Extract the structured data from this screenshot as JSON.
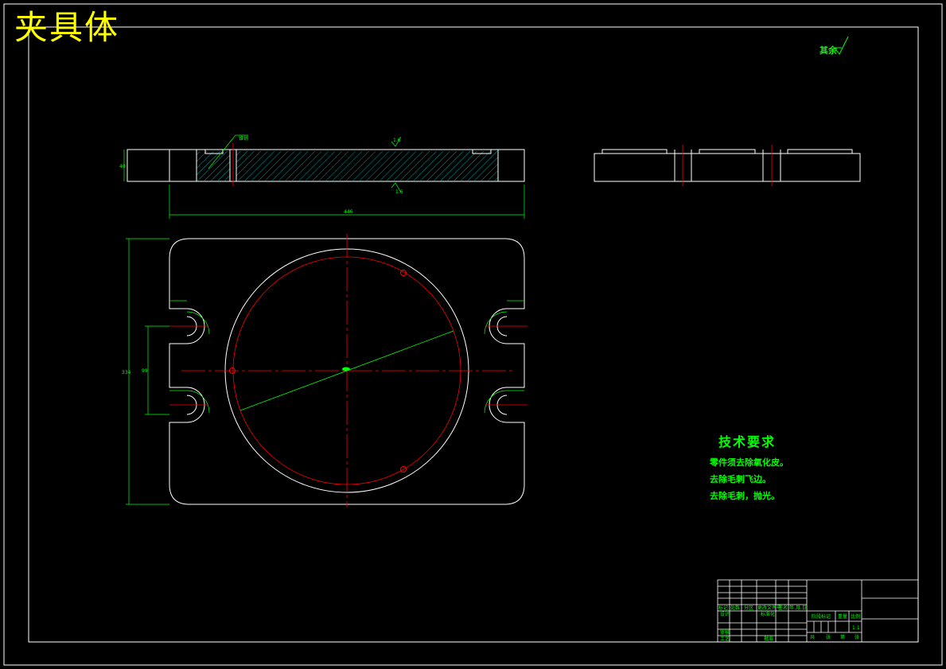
{
  "drawing": {
    "title": "夹具体",
    "roughness_note": "其余",
    "top_view_marks": {
      "left_callout": "锥销",
      "roughness_top": "1.6",
      "roughness_bottom": "1.6"
    },
    "technical_requirements": {
      "heading": "技术要求",
      "items": [
        "零件须去除氧化皮。",
        "去除毛刺飞边。",
        "去除毛刺，抛光。"
      ]
    },
    "title_block": {
      "row_labels": [
        "标记",
        "处数",
        "分区",
        "更改文件号",
        "签名",
        "年.月.日"
      ],
      "design_label": "设计",
      "standard_label": "标准化",
      "review_label": "审核",
      "process_label": "工艺",
      "approve_label": "批准",
      "stage_label": "阶段标记",
      "weight_label": "重量",
      "scale_label": "比例",
      "scale_value": "1:1",
      "sheet_text": [
        "共",
        "张",
        "第",
        "张"
      ]
    }
  },
  "colors": {
    "outline": "#ffffff",
    "dimension": "#00ff00",
    "centerline": "#ff0000",
    "title": "#ffff00"
  }
}
